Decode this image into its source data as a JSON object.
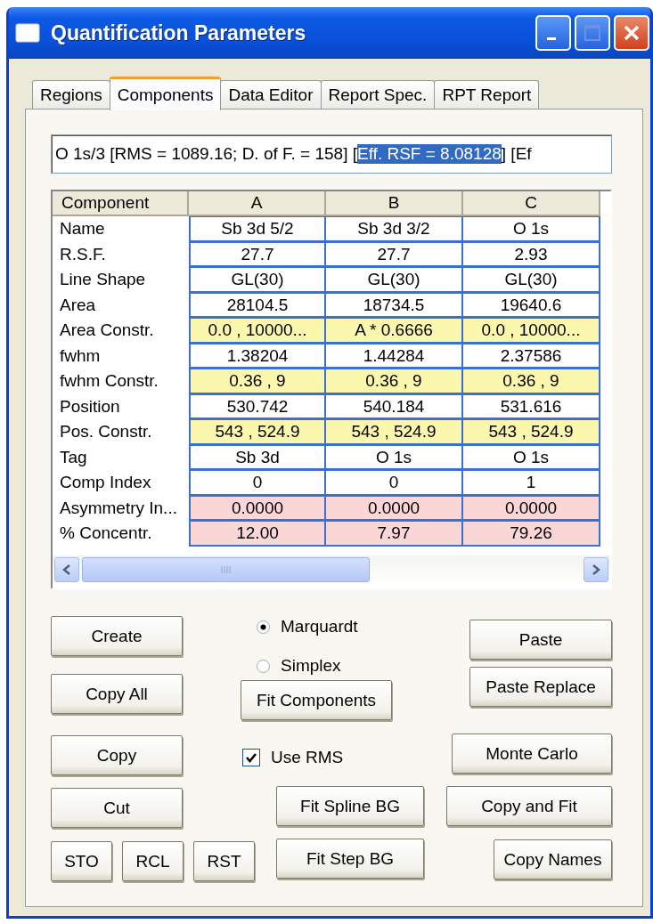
{
  "window": {
    "title": "Quantification Parameters"
  },
  "tabs": [
    {
      "label": "Regions",
      "selected": false
    },
    {
      "label": "Components",
      "selected": true
    },
    {
      "label": "Data Editor",
      "selected": false
    },
    {
      "label": "Report Spec.",
      "selected": false
    },
    {
      "label": "RPT Report",
      "selected": false
    }
  ],
  "summary_field": {
    "text_before": "O 1s/3 [RMS = 1089.16; D. of F. = 158] [",
    "selected_text": "Eff. RSF = 8.08128",
    "text_after": "] [Ef"
  },
  "table": {
    "columns": [
      "Component",
      "A",
      "B",
      "C"
    ],
    "rows": [
      {
        "kind": "plain",
        "cells": [
          "Name",
          "Sb 3d 5/2",
          "Sb 3d 3/2",
          "O 1s"
        ]
      },
      {
        "kind": "plain",
        "cells": [
          "R.S.F.",
          "27.7",
          "27.7",
          "2.93"
        ]
      },
      {
        "kind": "plain",
        "cells": [
          "Line Shape",
          "GL(30)",
          "GL(30)",
          "GL(30)"
        ]
      },
      {
        "kind": "plain",
        "cells": [
          "Area",
          "28104.5",
          "18734.5",
          "19640.6"
        ]
      },
      {
        "kind": "constraint",
        "cells": [
          "Area Constr.",
          "0.0 , 10000...",
          "A * 0.6666",
          "0.0 , 10000..."
        ]
      },
      {
        "kind": "plain",
        "cells": [
          "fwhm",
          "1.38204",
          "1.44284",
          "2.37586"
        ]
      },
      {
        "kind": "constraint",
        "cells": [
          "fwhm Constr.",
          "0.36 , 9",
          "0.36 , 9",
          "0.36 , 9"
        ]
      },
      {
        "kind": "plain",
        "cells": [
          "Position",
          "530.742",
          "540.184",
          "531.616"
        ]
      },
      {
        "kind": "constraint",
        "cells": [
          "Pos. Constr.",
          "543 , 524.9",
          "543 , 524.9",
          "543 , 524.9"
        ]
      },
      {
        "kind": "plain",
        "cells": [
          "Tag",
          "Sb 3d",
          "O 1s",
          "O 1s"
        ]
      },
      {
        "kind": "plain",
        "cells": [
          "Comp Index",
          "0",
          "0",
          "1"
        ]
      },
      {
        "kind": "result",
        "cells": [
          "Asymmetry In...",
          "0.0000",
          "0.0000",
          "0.0000"
        ]
      },
      {
        "kind": "result",
        "cells": [
          "% Concentr.",
          "12.00",
          "7.97",
          "79.26"
        ]
      }
    ]
  },
  "fit_method": [
    {
      "label": "Marquardt",
      "selected": true
    },
    {
      "label": "Simplex",
      "selected": false
    }
  ],
  "use_rms": {
    "label": "Use RMS",
    "checked": true
  },
  "buttons": {
    "left": [
      "Create",
      "Copy All",
      "Copy",
      "Cut"
    ],
    "registers": [
      "STO",
      "RCL",
      "RST"
    ],
    "middle": [
      "Fit Components",
      "Fit Spline BG",
      "Fit Step BG"
    ],
    "right": [
      "Paste",
      "Paste Replace",
      "Monte Carlo",
      "Copy and Fit",
      "Copy Names"
    ]
  }
}
